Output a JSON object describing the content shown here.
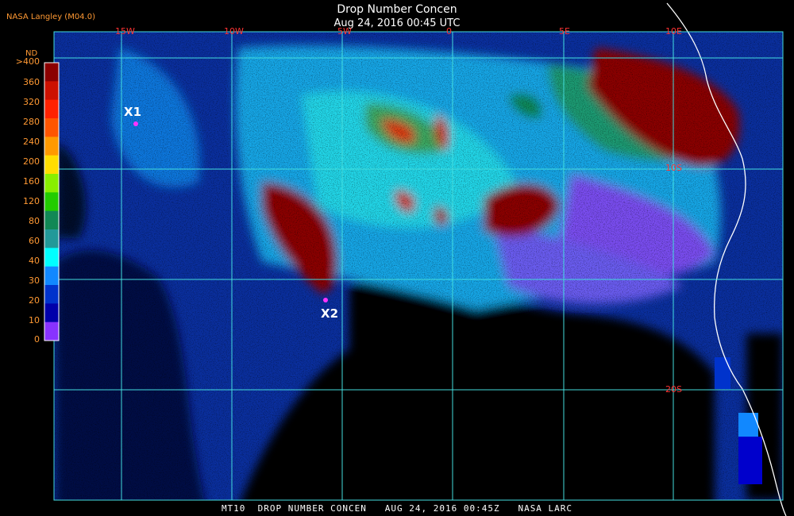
{
  "header": {
    "provider": "NASA Langley (M04.0)",
    "title": "Drop Number Concen",
    "subtitle": "Aug 24, 2016 00:45 UTC"
  },
  "legend": {
    "title": "ND",
    "labels": [
      ">400",
      "360",
      "320",
      "280",
      "240",
      "200",
      "160",
      "120",
      "80",
      "60",
      "40",
      "30",
      "20",
      "10",
      "0"
    ],
    "colors": [
      "#8b0000",
      "#cc1100",
      "#ff2200",
      "#ff5500",
      "#ff9900",
      "#ffdd00",
      "#88ee00",
      "#22cc00",
      "#118855",
      "#229999",
      "#00ffff",
      "#1188ff",
      "#0033cc",
      "#0000aa",
      "#8833ff"
    ]
  },
  "grid": {
    "lon_labels": [
      "15W",
      "10W",
      "5W",
      "0",
      "5E",
      "10E"
    ],
    "lat_labels": [
      "10S",
      "20S"
    ],
    "color": "#44dddd"
  },
  "markers": [
    "X1",
    "X2"
  ],
  "footer": "MT10  DROP NUMBER CONCEN   AUG 24, 2016 00:45Z   NASA LARC"
}
